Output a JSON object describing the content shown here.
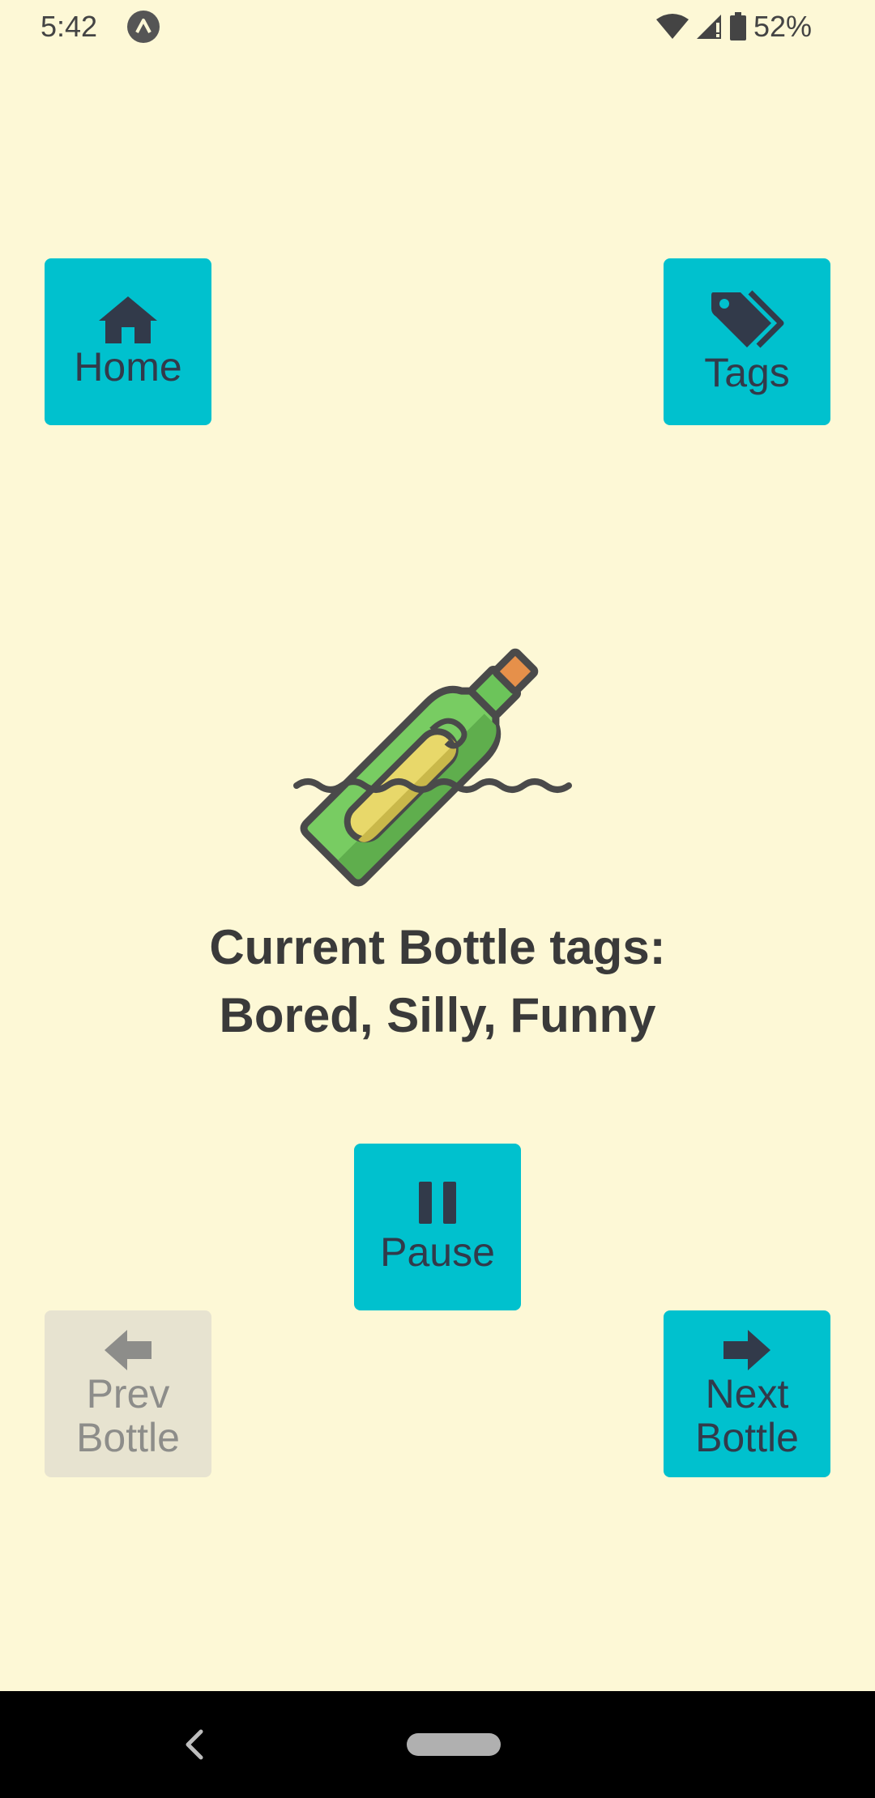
{
  "status_bar": {
    "time": "5:42",
    "battery": "52%",
    "icons": [
      "app-notification-icon",
      "wifi-icon",
      "cell-signal-icon",
      "battery-icon"
    ]
  },
  "buttons": {
    "home": {
      "label": "Home",
      "icon": "home-icon"
    },
    "tags": {
      "label": "Tags",
      "icon": "tag-icon"
    },
    "pause": {
      "label": "Pause",
      "icon": "pause-icon"
    },
    "prev": {
      "label": "Prev\nBottle",
      "icon": "arrow-left-icon",
      "enabled": false
    },
    "next": {
      "label": "Next\nBottle",
      "icon": "arrow-right-icon",
      "enabled": true
    }
  },
  "bottle": {
    "icon": "message-in-bottle-icon"
  },
  "tags_info": {
    "line1": "Current Bottle tags:",
    "line2": "Bored, Silly, Funny"
  },
  "colors": {
    "background": "#fdf8d6",
    "button": "#00c1ce",
    "button_disabled": "#e7e3d0",
    "icon_text": "#323a4a"
  },
  "nav_bar": {
    "icons": [
      "back-icon",
      "home-pill"
    ]
  }
}
